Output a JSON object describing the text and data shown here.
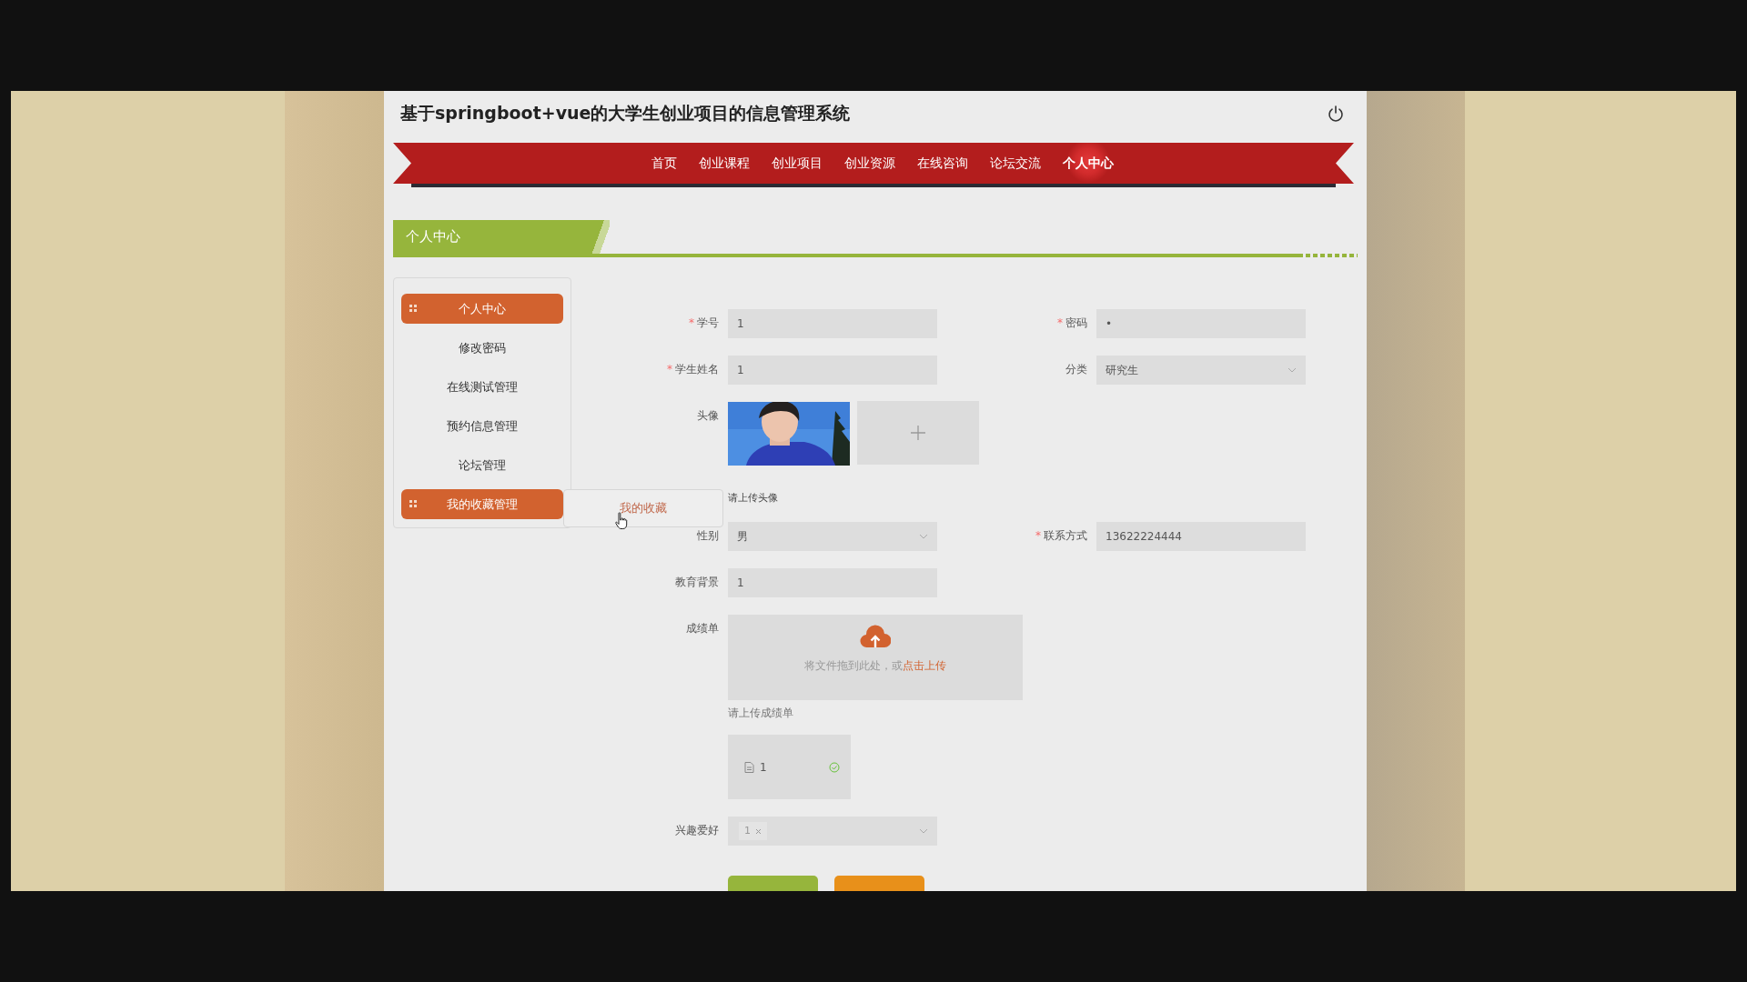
{
  "header": {
    "title": "基于springboot+vue的大学生创业项目的信息管理系统"
  },
  "nav": [
    {
      "label": "首页",
      "selected": false
    },
    {
      "label": "创业课程",
      "selected": false
    },
    {
      "label": "创业项目",
      "selected": false
    },
    {
      "label": "创业资源",
      "selected": false
    },
    {
      "label": "在线咨询",
      "selected": false
    },
    {
      "label": "论坛交流",
      "selected": false
    },
    {
      "label": "个人中心",
      "selected": true
    }
  ],
  "section": {
    "title": "个人中心"
  },
  "sidebar": {
    "items": [
      {
        "label": "个人中心",
        "selected": true
      },
      {
        "label": "修改密码",
        "selected": false
      },
      {
        "label": "在线测试管理",
        "selected": false
      },
      {
        "label": "预约信息管理",
        "selected": false
      },
      {
        "label": "论坛管理",
        "selected": false
      },
      {
        "label": "我的收藏管理",
        "selected": true,
        "children": [
          {
            "label": "我的收藏"
          }
        ]
      }
    ]
  },
  "form": {
    "rows": [
      [
        {
          "kind": "text",
          "label": "学号",
          "mark": "*",
          "value": "1"
        },
        {
          "kind": "text",
          "label": "密码",
          "mark": "*",
          "value": "•"
        }
      ],
      [
        {
          "kind": "text",
          "label": "学生姓名",
          "mark": "*",
          "value": "1"
        },
        {
          "kind": "select",
          "label": "分类",
          "value": "研究生"
        }
      ],
      [
        {
          "label": "头像",
          "hint": "请上传头像"
        }
      ],
      [
        {
          "kind": "select",
          "label": "性别",
          "value": "男"
        },
        {
          "kind": "text",
          "label": "联系方式",
          "mark": "*",
          "value": "13622224444"
        }
      ],
      [
        {
          "kind": "text",
          "label": "教育背景",
          "value": "1"
        }
      ],
      [
        {
          "kind": "upload",
          "label": "成绩单",
          "prompt": "将文件拖到此处，或",
          "link": "点击上传",
          "hint": "请上传成绩单",
          "files": [
            {
              "name": "1",
              "done": true
            }
          ]
        }
      ],
      [
        {
          "kind": "tags",
          "label": "兴趣爱好",
          "tags": [
            "1"
          ]
        }
      ]
    ],
    "buttons": [
      {
        "kind": "primary"
      },
      {
        "kind": "secondary"
      }
    ]
  }
}
